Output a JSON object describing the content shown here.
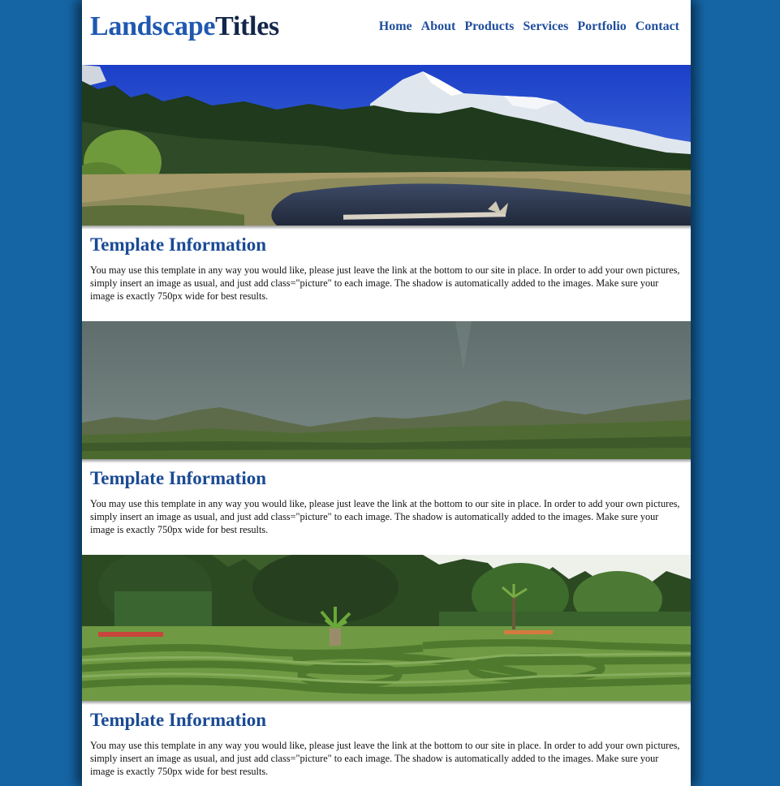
{
  "logo": {
    "part1": "Landscape",
    "part2": "Titles"
  },
  "nav": [
    {
      "label": "Home"
    },
    {
      "label": "About"
    },
    {
      "label": "Products"
    },
    {
      "label": "Services"
    },
    {
      "label": "Portfolio"
    },
    {
      "label": "Contact"
    }
  ],
  "sections": [
    {
      "image": "mountain-lake-forest-photo",
      "title": "Template Information",
      "body": "You may use this template in any way you would like, please just leave the link at the bottom to our site in place. In order to add your own pictures, simply insert an image as usual, and just add class=\"picture\" to each image. The shadow is automatically added to the images. Make sure your image is exactly 750px wide for best results."
    },
    {
      "image": "stormy-hills-photo",
      "title": "Template Information",
      "body": "You may use this template in any way you would like, please just leave the link at the bottom to our site in place. In order to add your own pictures, simply insert an image as usual, and just add class=\"picture\" to each image. The shadow is automatically added to the images. Make sure your image is exactly 750px wide for best results."
    },
    {
      "image": "hedge-maze-garden-photo",
      "title": "Template Information",
      "body": "You may use this template in any way you would like, please just leave the link at the bottom to our site in place. In order to add your own pictures, simply insert an image as usual, and just add class=\"picture\" to each image. The shadow is automatically added to the images. Make sure your image is exactly 750px wide for best results."
    }
  ],
  "colors": {
    "background": "#1565a5",
    "logo_primary": "#1f58b0",
    "logo_secondary": "#14264a",
    "nav_link": "#1f4e9e",
    "heading": "#1a4a94"
  }
}
